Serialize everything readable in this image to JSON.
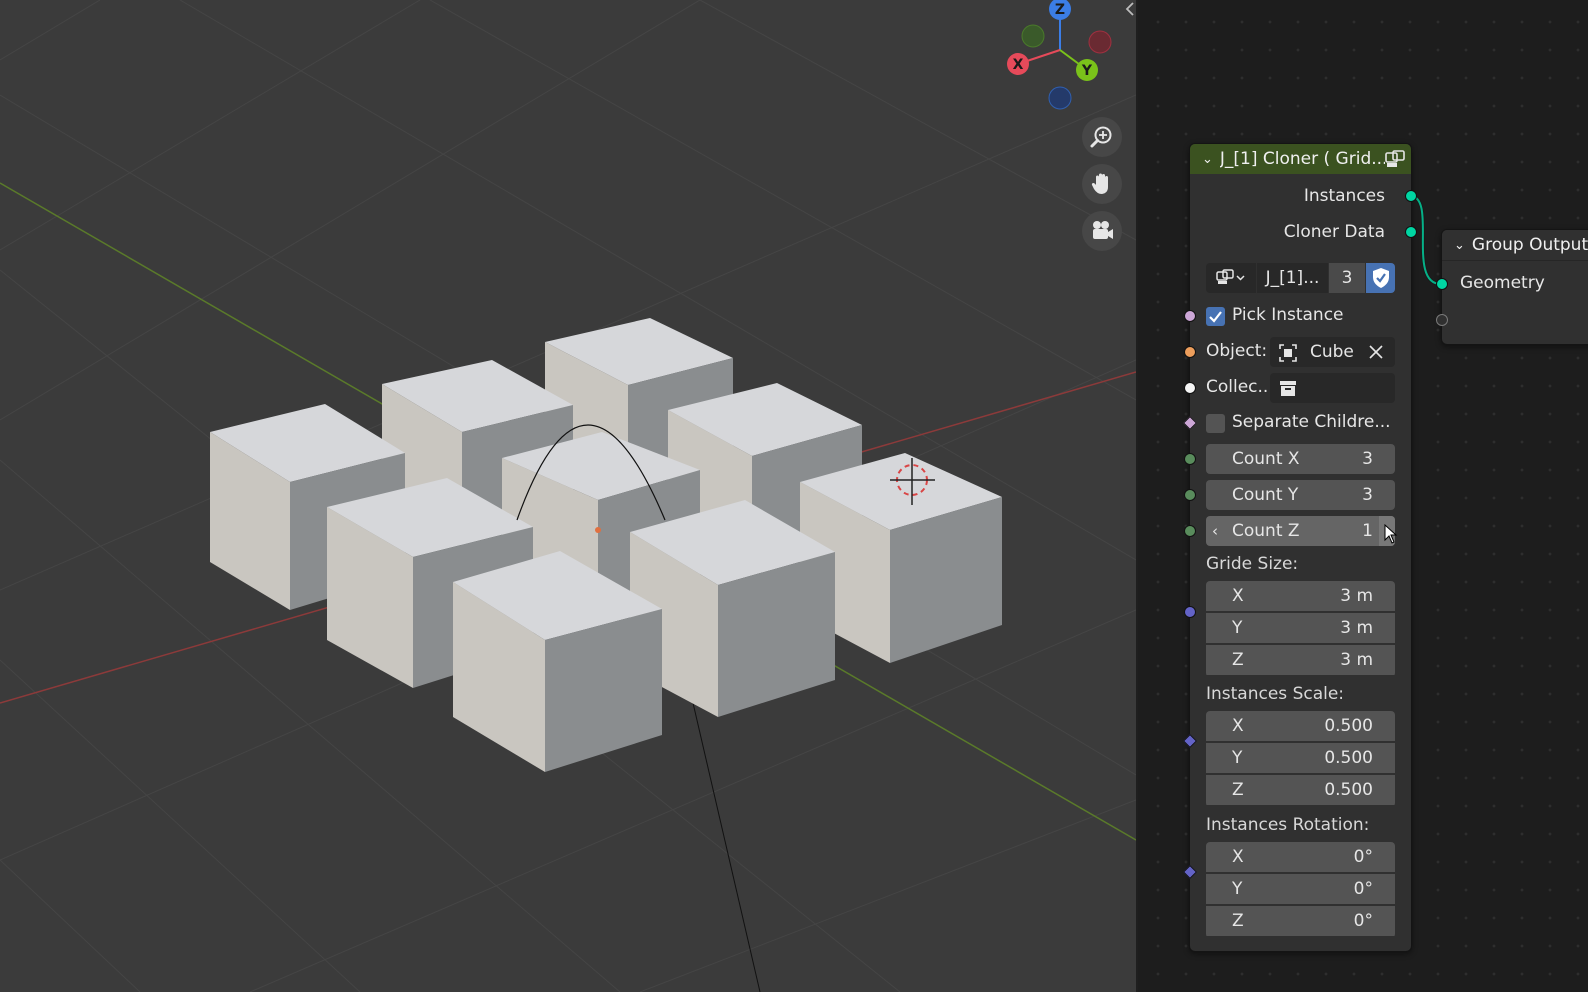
{
  "viewport": {
    "gizmo": {
      "x_label": "X",
      "y_label": "Y",
      "z_label": "Z"
    },
    "nav_icons": [
      "zoom-icon",
      "hand-pan-icon",
      "camera-icon"
    ]
  },
  "cloner_node": {
    "title": "J_[1] Cloner ( Grid...",
    "outputs": {
      "instances": "Instances",
      "cloner_data": "Cloner Data"
    },
    "datablock": {
      "name": "J_[1]...",
      "users": "3"
    },
    "pick_instance": {
      "label": "Pick Instance",
      "checked": true
    },
    "object": {
      "label": "Object:",
      "value": "Cube"
    },
    "collection": {
      "label": "Collec..."
    },
    "separate_children": {
      "label": "Separate Childre...",
      "checked": false
    },
    "count_x": {
      "label": "Count X",
      "value": "3"
    },
    "count_y": {
      "label": "Count Y",
      "value": "3"
    },
    "count_z": {
      "label": "Count Z",
      "value": "1"
    },
    "grid_size": {
      "label": "Gride Size:",
      "x": {
        "label": "X",
        "value": "3 m"
      },
      "y": {
        "label": "Y",
        "value": "3 m"
      },
      "z": {
        "label": "Z",
        "value": "3 m"
      }
    },
    "instances_scale": {
      "label": "Instances Scale:",
      "x": {
        "label": "X",
        "value": "0.500"
      },
      "y": {
        "label": "Y",
        "value": "0.500"
      },
      "z": {
        "label": "Z",
        "value": "0.500"
      }
    },
    "instances_rotation": {
      "label": "Instances Rotation:",
      "x": {
        "label": "X",
        "value": "0°"
      },
      "y": {
        "label": "Y",
        "value": "0°"
      },
      "z": {
        "label": "Z",
        "value": "0°"
      }
    }
  },
  "group_output_node": {
    "title": "Group Output",
    "input": "Geometry"
  },
  "colors": {
    "header_green": "#3b5220",
    "socket_geometry": "#00d6a3",
    "socket_int": "#598c5c",
    "socket_vector": "#6363c7",
    "socket_bool": "#cca6d6",
    "socket_object": "#ed9e5c",
    "socket_collection": "#f5f5f5",
    "checkbox_blue": "#4772b3"
  }
}
